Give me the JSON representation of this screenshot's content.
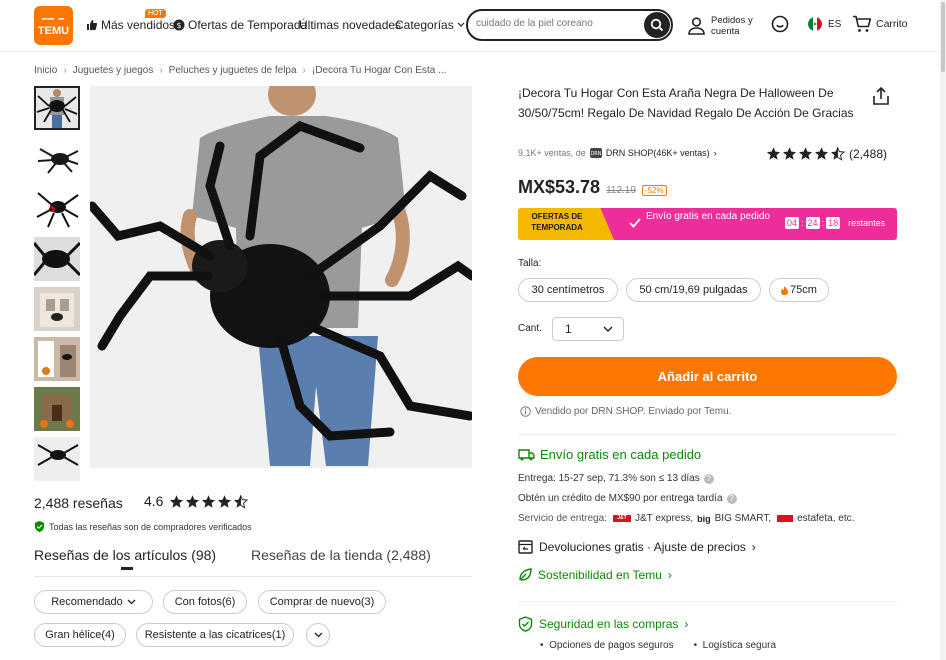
{
  "header": {
    "logo_top": "━━ ━",
    "logo_text": "TEMU",
    "hot_badge": "HOT",
    "nav": [
      "Más vendidos",
      "Ofertas de Temporada",
      "Últimas novedades",
      "Categorías"
    ],
    "search_placeholder": "cuidado de la piel coreano",
    "account": "Pedidos y cuenta",
    "lang": "ES",
    "cart": "Carrito"
  },
  "breadcrumb": [
    "Inicio",
    "Juguetes y juegos",
    "Peluches y juguetes de felpa",
    "¡Decora Tu Hogar Con Esta ..."
  ],
  "product": {
    "title": "¡Decora Tu Hogar Con Esta Araña Negra De Halloween De 30/50/75cm! Regalo De Navidad Regalo De Acción De Gracias",
    "sold": "9.1K+ ventas, de",
    "shop": "DRN SHOP(46K+ ventas)",
    "rating_count": "(2,488)",
    "rating": 4.6,
    "price": "MX$53.78",
    "old_price": "112.19",
    "discount": "-52%",
    "promo_badge": "OFERTAS DE TEMPORADA",
    "promo_text": "Envío gratis en cada pedido",
    "timer": [
      "04",
      "24",
      "18"
    ],
    "timer_suffix": "restantes",
    "size_label": "Talla:",
    "sizes": [
      "30 centímetros",
      "50 cm/19,69 pulgadas",
      "75cm"
    ],
    "qty_label": "Cant.",
    "qty_value": "1",
    "add_to_cart": "Añadir al carrito",
    "sold_by": "Vendido por DRN SHOP. Enviado por Temu."
  },
  "shipping": {
    "title": "Envío gratis en cada pedido",
    "delivery": "Entrega: 15-27 sep, 71.3% son ≤ 13 días",
    "credit": "Obtén un crédito de MX$90 por entrega tardía",
    "service_label": "Servicio de entrega:",
    "carriers": [
      "J&T express,",
      "BIG SMART,",
      "estafeta, etc."
    ],
    "carrier_logos": [
      "J&T",
      "big"
    ]
  },
  "sections": {
    "returns": "Devoluciones gratis · Ajuste de precios",
    "sustainability": "Sostenibilidad en Temu",
    "security": "Seguridad en las compras",
    "security_items": [
      "Opciones de pagos seguros",
      "Logística segura"
    ]
  },
  "reviews": {
    "count": "2,488 reseñas",
    "rating": "4.6",
    "verified": "Todas las reseñas son de compradores verificados",
    "tabs": [
      "Reseñas de los artículos (98)",
      "Reseñas de la tienda (2,488)"
    ],
    "chips": [
      "Recomendado",
      "Con fotos(6)",
      "Comprar de nuevo(3)",
      "Gran hélice(4)",
      "Resistente a las cicatrices(1)"
    ]
  },
  "colors": {
    "accent": "#fb7701",
    "promo_pink": "#ef2d9a",
    "promo_yellow": "#f5b800",
    "green": "#0a8a00"
  }
}
